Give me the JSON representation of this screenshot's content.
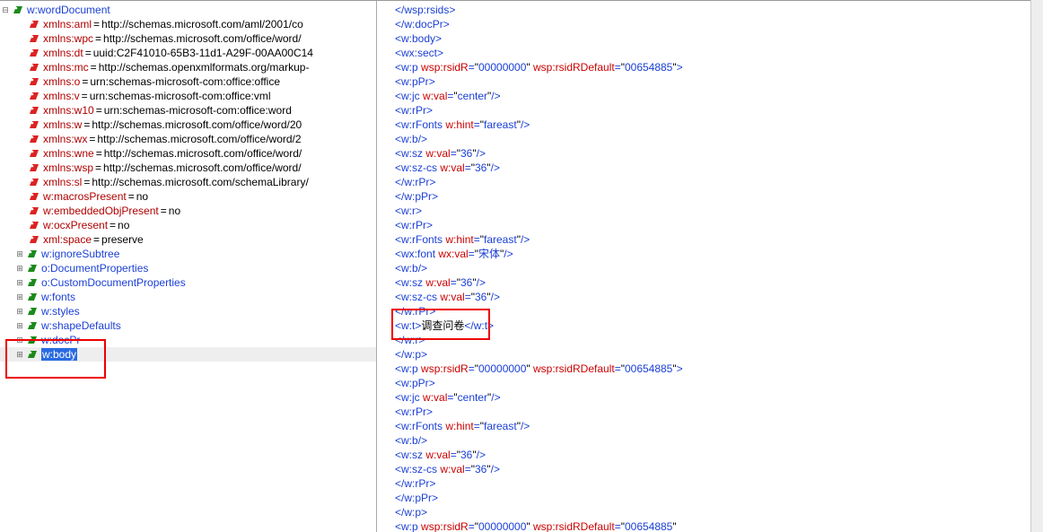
{
  "tree": {
    "root": {
      "name": "w:wordDocument",
      "kind": "el",
      "twisty": "minus",
      "indent": 0
    },
    "attrs": [
      {
        "name": "xmlns:aml",
        "val": "http://schemas.microsoft.com/aml/2001/co"
      },
      {
        "name": "xmlns:wpc",
        "val": "http://schemas.microsoft.com/office/word/"
      },
      {
        "name": "xmlns:dt",
        "val": "uuid:C2F41010-65B3-11d1-A29F-00AA00C14"
      },
      {
        "name": "xmlns:mc",
        "val": "http://schemas.openxmlformats.org/markup-"
      },
      {
        "name": "xmlns:o",
        "val": "urn:schemas-microsoft-com:office:office"
      },
      {
        "name": "xmlns:v",
        "val": "urn:schemas-microsoft-com:office:vml"
      },
      {
        "name": "xmlns:w10",
        "val": "urn:schemas-microsoft-com:office:word"
      },
      {
        "name": "xmlns:w",
        "val": "http://schemas.microsoft.com/office/word/20"
      },
      {
        "name": "xmlns:wx",
        "val": "http://schemas.microsoft.com/office/word/2"
      },
      {
        "name": "xmlns:wne",
        "val": "http://schemas.microsoft.com/office/word/"
      },
      {
        "name": "xmlns:wsp",
        "val": "http://schemas.microsoft.com/office/word/"
      },
      {
        "name": "xmlns:sl",
        "val": "http://schemas.microsoft.com/schemaLibrary/"
      },
      {
        "name": "w:macrosPresent",
        "val": "no"
      },
      {
        "name": "w:embeddedObjPresent",
        "val": "no"
      },
      {
        "name": "w:ocxPresent",
        "val": "no"
      },
      {
        "name": "xml:space",
        "val": "preserve"
      }
    ],
    "children": [
      {
        "name": "w:ignoreSubtree",
        "kind": "el",
        "twisty": "plus"
      },
      {
        "name": "o:DocumentProperties",
        "kind": "el",
        "twisty": "plus"
      },
      {
        "name": "o:CustomDocumentProperties",
        "kind": "el",
        "twisty": "plus"
      },
      {
        "name": "w:fonts",
        "kind": "el",
        "twisty": "plus"
      },
      {
        "name": "w:styles",
        "kind": "el",
        "twisty": "plus"
      },
      {
        "name": "w:shapeDefaults",
        "kind": "el",
        "twisty": "plus"
      },
      {
        "name": "w:docPr",
        "kind": "el",
        "twisty": "plus"
      },
      {
        "name": "w:body",
        "kind": "el",
        "twisty": "plus",
        "selected": true
      }
    ]
  },
  "code": [
    {
      "t": "close",
      "tag": "wsp:rsids"
    },
    {
      "t": "close",
      "tag": "w:docPr"
    },
    {
      "t": "open",
      "tag": "w:body"
    },
    {
      "t": "open",
      "tag": "wx:sect"
    },
    {
      "t": "open",
      "tag": "w:p",
      "attrs": [
        [
          "wsp:rsidR",
          "00000000"
        ],
        [
          "wsp:rsidRDefault",
          "00654885"
        ]
      ]
    },
    {
      "t": "open",
      "tag": "w:pPr"
    },
    {
      "t": "empty",
      "tag": "w:jc",
      "attrs": [
        [
          "w:val",
          "center"
        ]
      ]
    },
    {
      "t": "open",
      "tag": "w:rPr"
    },
    {
      "t": "empty",
      "tag": "w:rFonts",
      "attrs": [
        [
          "w:hint",
          "fareast"
        ]
      ]
    },
    {
      "t": "empty",
      "tag": "w:b"
    },
    {
      "t": "empty",
      "tag": "w:sz",
      "attrs": [
        [
          "w:val",
          "36"
        ]
      ]
    },
    {
      "t": "empty",
      "tag": "w:sz-cs",
      "attrs": [
        [
          "w:val",
          "36"
        ]
      ]
    },
    {
      "t": "close",
      "tag": "w:rPr"
    },
    {
      "t": "close",
      "tag": "w:pPr"
    },
    {
      "t": "open",
      "tag": "w:r"
    },
    {
      "t": "open",
      "tag": "w:rPr"
    },
    {
      "t": "empty",
      "tag": "w:rFonts",
      "attrs": [
        [
          "w:hint",
          "fareast"
        ]
      ]
    },
    {
      "t": "empty",
      "tag": "wx:font",
      "attrs": [
        [
          "wx:val",
          "宋体"
        ]
      ]
    },
    {
      "t": "empty",
      "tag": "w:b"
    },
    {
      "t": "empty",
      "tag": "w:sz",
      "attrs": [
        [
          "w:val",
          "36"
        ]
      ]
    },
    {
      "t": "empty",
      "tag": "w:sz-cs",
      "attrs": [
        [
          "w:val",
          "36"
        ]
      ]
    },
    {
      "t": "close",
      "tag": "w:rPr"
    },
    {
      "t": "textc",
      "tag": "w:t",
      "text": "调查问卷"
    },
    {
      "t": "close",
      "tag": "w:r"
    },
    {
      "t": "close",
      "tag": "w:p"
    },
    {
      "t": "open",
      "tag": "w:p",
      "attrs": [
        [
          "wsp:rsidR",
          "00000000"
        ],
        [
          "wsp:rsidRDefault",
          "00654885"
        ]
      ]
    },
    {
      "t": "open",
      "tag": "w:pPr"
    },
    {
      "t": "empty",
      "tag": "w:jc",
      "attrs": [
        [
          "w:val",
          "center"
        ]
      ]
    },
    {
      "t": "open",
      "tag": "w:rPr"
    },
    {
      "t": "empty",
      "tag": "w:rFonts",
      "attrs": [
        [
          "w:hint",
          "fareast"
        ]
      ]
    },
    {
      "t": "empty",
      "tag": "w:b"
    },
    {
      "t": "empty",
      "tag": "w:sz",
      "attrs": [
        [
          "w:val",
          "36"
        ]
      ]
    },
    {
      "t": "empty",
      "tag": "w:sz-cs",
      "attrs": [
        [
          "w:val",
          "36"
        ]
      ]
    },
    {
      "t": "close",
      "tag": "w:rPr"
    },
    {
      "t": "close",
      "tag": "w:pPr"
    },
    {
      "t": "close",
      "tag": "w:p"
    },
    {
      "t": "open",
      "tag": "w:p",
      "attrs": [
        [
          "wsp:rsidR",
          "00000000"
        ],
        [
          "wsp:rsidRDefault",
          "00654885"
        ]
      ],
      "cut": true
    }
  ]
}
